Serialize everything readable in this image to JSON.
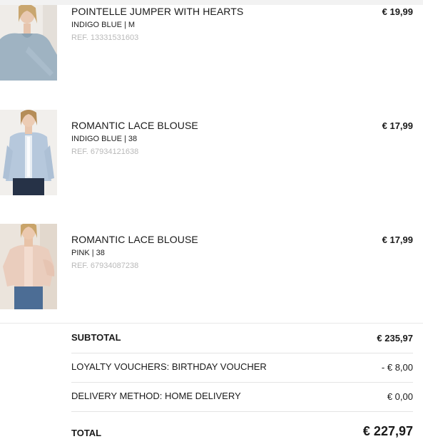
{
  "items": [
    {
      "name": "POINTELLE JUMPER WITH HEARTS",
      "variant": "INDIGO BLUE | M",
      "ref": "REF. 13331531603",
      "price": "€ 19,99"
    },
    {
      "name": "ROMANTIC LACE BLOUSE",
      "variant": "INDIGO BLUE | 38",
      "ref": "REF. 67934121638",
      "price": "€ 17,99"
    },
    {
      "name": "ROMANTIC LACE BLOUSE",
      "variant": "PINK | 38",
      "ref": "REF. 67934087238",
      "price": "€ 17,99"
    }
  ],
  "summary": {
    "subtotal_label": "SUBTOTAL",
    "subtotal_value": "€ 235,97",
    "voucher_label": "LOYALTY VOUCHERS: BIRTHDAY VOUCHER",
    "voucher_value": "- € 8,00",
    "delivery_label": "DELIVERY METHOD: HOME DELIVERY",
    "delivery_value": "€ 0,00",
    "total_label": "TOTAL",
    "total_value": "€ 227,97"
  }
}
